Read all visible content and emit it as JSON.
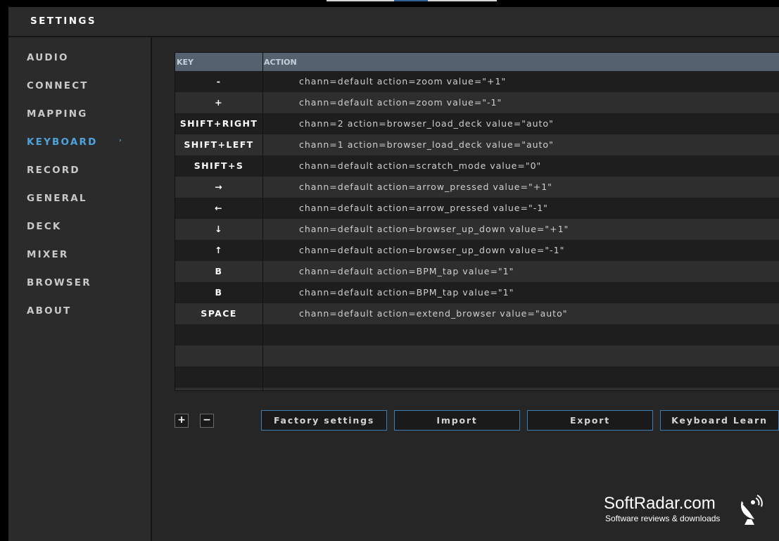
{
  "header": {
    "title": "SETTINGS"
  },
  "sidebar": {
    "items": [
      {
        "label": "AUDIO",
        "active": false
      },
      {
        "label": "CONNECT",
        "active": false
      },
      {
        "label": "MAPPING",
        "active": false
      },
      {
        "label": "KEYBOARD",
        "active": true
      },
      {
        "label": "RECORD",
        "active": false
      },
      {
        "label": "GENERAL",
        "active": false
      },
      {
        "label": "DECK",
        "active": false
      },
      {
        "label": "MIXER",
        "active": false
      },
      {
        "label": "BROWSER",
        "active": false
      },
      {
        "label": "ABOUT",
        "active": false
      }
    ],
    "active_arrow": "›"
  },
  "table": {
    "columns": {
      "key": "KEY",
      "action": "ACTION"
    },
    "rows": [
      {
        "key": "-",
        "action": "chann=default  action=zoom value=\"+1\""
      },
      {
        "key": "+",
        "action": "chann=default  action=zoom value=\"-1\""
      },
      {
        "key": "SHIFT+RIGHT",
        "action": "chann=2  action=browser_load_deck value=\"auto\""
      },
      {
        "key": "SHIFT+LEFT",
        "action": "chann=1  action=browser_load_deck value=\"auto\""
      },
      {
        "key": "SHIFT+S",
        "action": "chann=default  action=scratch_mode value=\"0\""
      },
      {
        "key": "→",
        "action": "chann=default  action=arrow_pressed value=\"+1\""
      },
      {
        "key": "←",
        "action": "chann=default  action=arrow_pressed value=\"-1\""
      },
      {
        "key": "↓",
        "action": "chann=default  action=browser_up_down value=\"+1\""
      },
      {
        "key": "↑",
        "action": "chann=default  action=browser_up_down value=\"-1\""
      },
      {
        "key": "B",
        "action": "chann=default  action=BPM_tap value=\"1\""
      },
      {
        "key": "B",
        "action": "chann=default  action=BPM_tap value=\"1\""
      },
      {
        "key": "SPACE",
        "action": "chann=default  action=extend_browser value=\"auto\""
      }
    ]
  },
  "buttons": {
    "add": "+",
    "remove": "−",
    "factory": "Factory settings",
    "import": "Import",
    "export": "Export",
    "learn": "Keyboard Learn"
  },
  "watermark": {
    "title": "SoftRadar.com",
    "subtitle": "Software reviews & downloads"
  },
  "colors": {
    "accent": "#4fa3dc",
    "button_border": "#3f7db0",
    "table_header": "#546270"
  }
}
